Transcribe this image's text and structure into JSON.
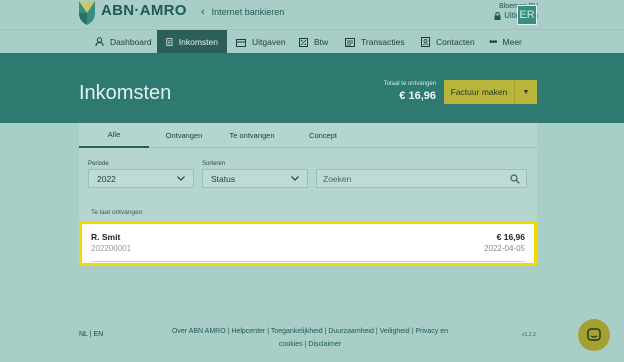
{
  "header": {
    "logo_text": "ABN·AMRO",
    "back_link": "Internet bankieren",
    "company_name": "Bloemen BV",
    "logout_label": "Uitloggen",
    "avatar_initials": "ER"
  },
  "nav": {
    "items": [
      {
        "label": "Dashboard",
        "icon": "dashboard-icon",
        "active": false
      },
      {
        "label": "Inkomsten",
        "icon": "document-icon",
        "active": true
      },
      {
        "label": "Uitgaven",
        "icon": "wallet-icon",
        "active": false
      },
      {
        "label": "Btw",
        "icon": "tax-icon",
        "active": false
      },
      {
        "label": "Transacties",
        "icon": "list-icon",
        "active": false
      },
      {
        "label": "Contacten",
        "icon": "contacts-icon",
        "active": false
      },
      {
        "label": "Meer",
        "icon": "more-icon",
        "active": false
      }
    ]
  },
  "banner": {
    "title": "Inkomsten",
    "total_label": "Totaal te ontvangen",
    "total_value": "€ 16,96",
    "create_button": "Factuur maken"
  },
  "tabs": [
    {
      "label": "Alle",
      "active": true
    },
    {
      "label": "Ontvangen",
      "active": false
    },
    {
      "label": "Te ontvangen",
      "active": false
    },
    {
      "label": "Concept",
      "active": false
    }
  ],
  "filters": {
    "period_label": "Periode",
    "period_value": "2022",
    "sort_label": "Sorteren",
    "sort_value": "Status",
    "search_placeholder": "Zoeken"
  },
  "section_label": "Te laat ontvangen",
  "invoice": {
    "name": "R. Smit",
    "number": "202200001",
    "amount": "€ 16,96",
    "date": "2022-04-05"
  },
  "footer": {
    "lang_nl": "NL",
    "lang_sep": "|",
    "lang_en": "EN",
    "links": [
      "Over ABN AMRO",
      "Helpcenter",
      "Toegankelijkheid",
      "Duurzaamheid",
      "Veiligheid",
      "Privacy en cookies",
      "Disclaimer"
    ],
    "separator": "|",
    "version": "v1.2.3"
  },
  "colors": {
    "accent": "#2e7a70",
    "active_nav": "#2d5f5a",
    "primary_button": "#b9b53a",
    "highlight": "#f0d800"
  }
}
